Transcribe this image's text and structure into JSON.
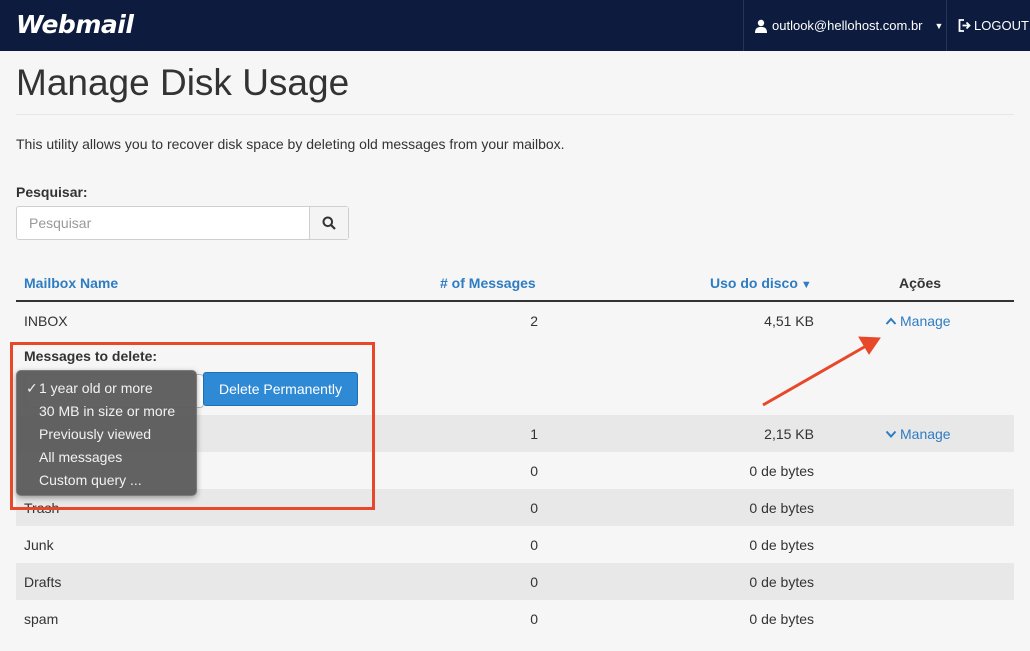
{
  "header": {
    "logo": "Webmail",
    "user_email": "outlook@hellohost.com.br",
    "logout_label": "LOGOUT"
  },
  "page": {
    "title": "Manage Disk Usage",
    "intro": "This utility allows you to recover disk space by deleting old messages from your mailbox."
  },
  "search": {
    "label": "Pesquisar:",
    "placeholder": "Pesquisar"
  },
  "table": {
    "headers": {
      "mailbox": "Mailbox Name",
      "messages": "# of Messages",
      "usage": "Uso do disco",
      "usage_sort": "▼",
      "actions": "Ações"
    },
    "rows": [
      {
        "name": "INBOX",
        "messages": "2",
        "usage": "4,51 KB",
        "action": "Manage"
      },
      {
        "name": "",
        "messages": "1",
        "usage": "2,15 KB",
        "action": "Manage"
      },
      {
        "name": "",
        "messages": "0",
        "usage": "0 de bytes",
        "action": ""
      },
      {
        "name": "Trash",
        "messages": "0",
        "usage": "0 de bytes",
        "action": ""
      },
      {
        "name": "Junk",
        "messages": "0",
        "usage": "0 de bytes",
        "action": ""
      },
      {
        "name": "Drafts",
        "messages": "0",
        "usage": "0 de bytes",
        "action": ""
      },
      {
        "name": "spam",
        "messages": "0",
        "usage": "0 de bytes",
        "action": ""
      }
    ]
  },
  "delete_panel": {
    "label": "Messages to delete:",
    "button": "Delete Permanently",
    "options": [
      "1 year old or more",
      "30 MB in size or more",
      "Previously viewed",
      "All messages",
      "Custom query ..."
    ],
    "selected_check": "✓"
  },
  "colors": {
    "navbar": "#0d1b3e",
    "link": "#2e7cc2",
    "primary_button": "#2f8ad6",
    "highlight": "#e8472a"
  }
}
